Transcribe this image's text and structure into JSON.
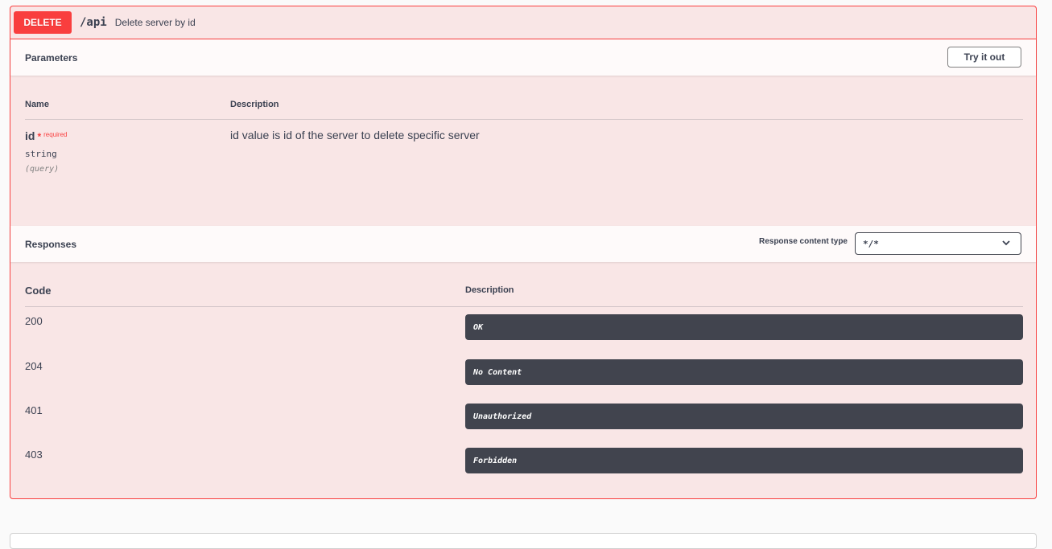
{
  "operation": {
    "method": "DELETE",
    "path": "/api",
    "summary": "Delete server by id"
  },
  "parameters": {
    "title": "Parameters",
    "try_button": "Try it out",
    "columns": {
      "name": "Name",
      "description": "Description"
    },
    "items": [
      {
        "name": "id",
        "star": "*",
        "required_label": "required",
        "type": "string",
        "in": "(query)",
        "description": "id value is id of the server to delete specific server"
      }
    ]
  },
  "responses": {
    "title": "Responses",
    "content_type_label": "Response content type",
    "content_type_value": "*/*",
    "columns": {
      "code": "Code",
      "description": "Description"
    },
    "items": [
      {
        "code": "200",
        "description": "OK"
      },
      {
        "code": "204",
        "description": "No Content"
      },
      {
        "code": "401",
        "description": "Unauthorized"
      },
      {
        "code": "403",
        "description": "Forbidden"
      }
    ]
  },
  "colors": {
    "delete_accent": "#f93e3e",
    "block_background": "#fcebeb",
    "response_box": "#41444e",
    "text": "#3b4151"
  },
  "icons": {
    "select_chevron": "chevron-down-icon"
  }
}
